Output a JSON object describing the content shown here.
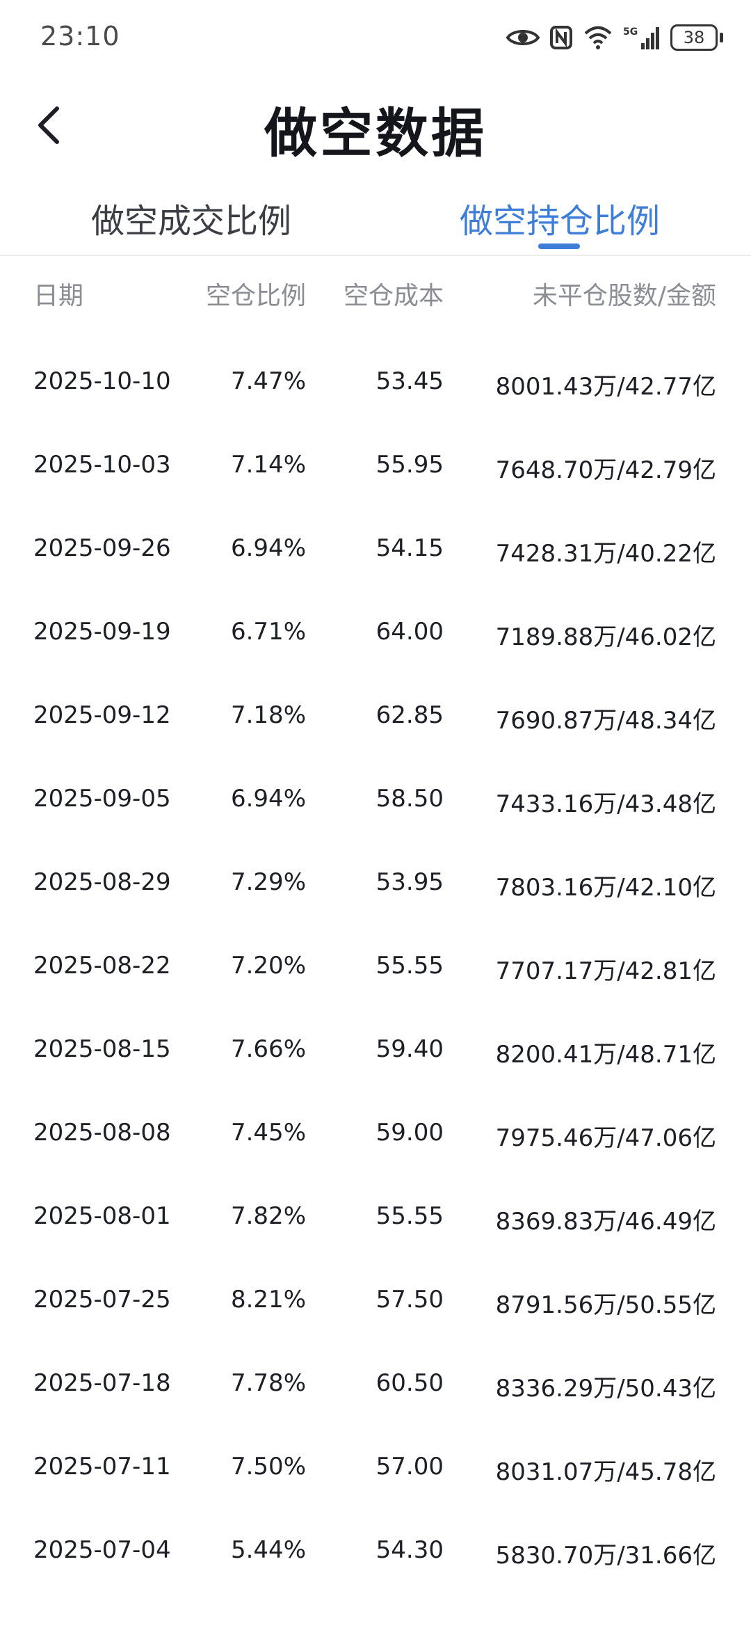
{
  "status_bar": {
    "time": "23:10",
    "battery": "38",
    "icons": [
      "eye-icon",
      "nfc-icon",
      "wifi-icon",
      "5g-signal-icon",
      "battery-icon"
    ]
  },
  "header": {
    "title": "做空数据",
    "back_icon": "chevron-left-icon"
  },
  "tabs": [
    {
      "label": "做空成交比例",
      "active": false
    },
    {
      "label": "做空持仓比例",
      "active": true
    }
  ],
  "colors": {
    "accent": "#3f7ed8",
    "header_text": "#8a8d94"
  },
  "table": {
    "columns": [
      "日期",
      "空仓比例",
      "空仓成本",
      "未平仓股数/金额"
    ],
    "rows": [
      {
        "date": "2025-10-10",
        "ratio": "7.47%",
        "cost": "53.45",
        "amount": "8001.43万/42.77亿"
      },
      {
        "date": "2025-10-03",
        "ratio": "7.14%",
        "cost": "55.95",
        "amount": "7648.70万/42.79亿"
      },
      {
        "date": "2025-09-26",
        "ratio": "6.94%",
        "cost": "54.15",
        "amount": "7428.31万/40.22亿"
      },
      {
        "date": "2025-09-19",
        "ratio": "6.71%",
        "cost": "64.00",
        "amount": "7189.88万/46.02亿"
      },
      {
        "date": "2025-09-12",
        "ratio": "7.18%",
        "cost": "62.85",
        "amount": "7690.87万/48.34亿"
      },
      {
        "date": "2025-09-05",
        "ratio": "6.94%",
        "cost": "58.50",
        "amount": "7433.16万/43.48亿"
      },
      {
        "date": "2025-08-29",
        "ratio": "7.29%",
        "cost": "53.95",
        "amount": "7803.16万/42.10亿"
      },
      {
        "date": "2025-08-22",
        "ratio": "7.20%",
        "cost": "55.55",
        "amount": "7707.17万/42.81亿"
      },
      {
        "date": "2025-08-15",
        "ratio": "7.66%",
        "cost": "59.40",
        "amount": "8200.41万/48.71亿"
      },
      {
        "date": "2025-08-08",
        "ratio": "7.45%",
        "cost": "59.00",
        "amount": "7975.46万/47.06亿"
      },
      {
        "date": "2025-08-01",
        "ratio": "7.82%",
        "cost": "55.55",
        "amount": "8369.83万/46.49亿"
      },
      {
        "date": "2025-07-25",
        "ratio": "8.21%",
        "cost": "57.50",
        "amount": "8791.56万/50.55亿"
      },
      {
        "date": "2025-07-18",
        "ratio": "7.78%",
        "cost": "60.50",
        "amount": "8336.29万/50.43亿"
      },
      {
        "date": "2025-07-11",
        "ratio": "7.50%",
        "cost": "57.00",
        "amount": "8031.07万/45.78亿"
      },
      {
        "date": "2025-07-04",
        "ratio": "5.44%",
        "cost": "54.30",
        "amount": "5830.70万/31.66亿"
      }
    ]
  }
}
